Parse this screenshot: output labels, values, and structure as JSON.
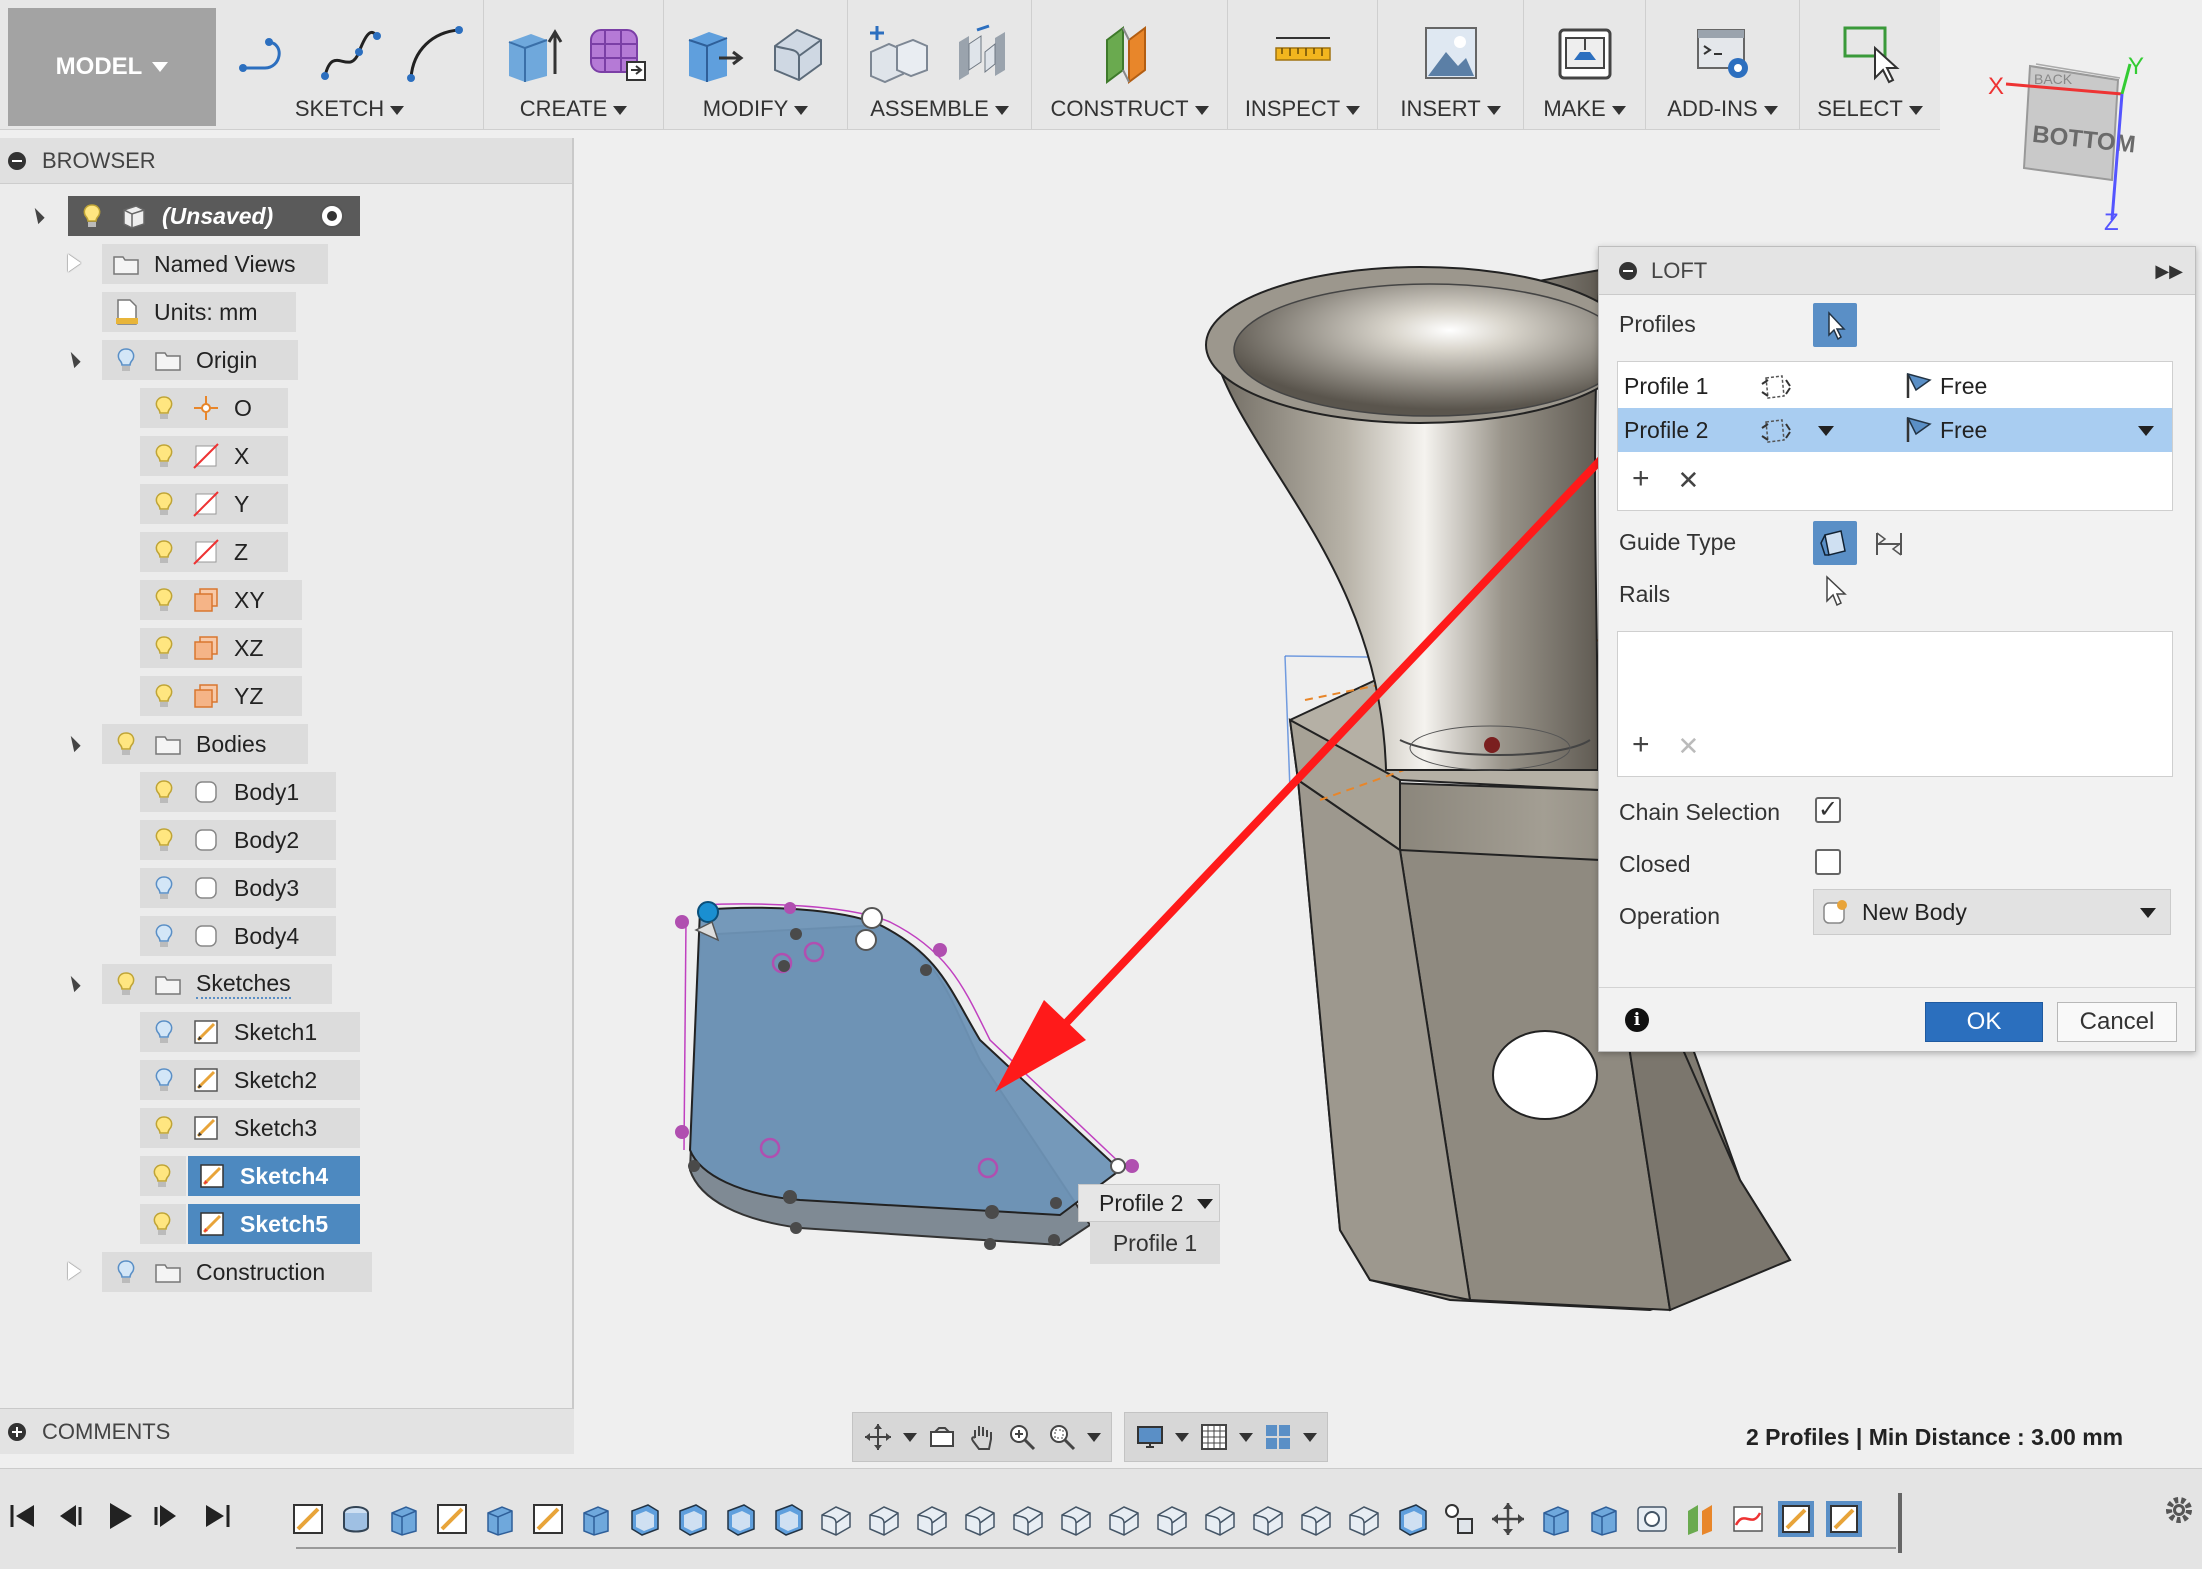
{
  "toolbar": {
    "model": "MODEL",
    "groups": [
      {
        "label": "SKETCH"
      },
      {
        "label": "CREATE"
      },
      {
        "label": "MODIFY"
      },
      {
        "label": "ASSEMBLE"
      },
      {
        "label": "CONSTRUCT"
      },
      {
        "label": "INSPECT"
      },
      {
        "label": "INSERT"
      },
      {
        "label": "MAKE"
      },
      {
        "label": "ADD-INS"
      },
      {
        "label": "SELECT"
      }
    ]
  },
  "viewcube": {
    "face": "BOTTOM",
    "back_face": "BACK",
    "x": "X",
    "y": "Y",
    "z": "Z"
  },
  "browser": {
    "title": "BROWSER",
    "root": "(Unsaved)",
    "named_views": "Named Views",
    "units": "Units: mm",
    "origin": "Origin",
    "origin_items": [
      "O",
      "X",
      "Y",
      "Z",
      "XY",
      "XZ",
      "YZ"
    ],
    "bodies": "Bodies",
    "body_items": [
      "Body1",
      "Body2",
      "Body3",
      "Body4"
    ],
    "sketches": "Sketches",
    "sketch_items": [
      "Sketch1",
      "Sketch2",
      "Sketch3",
      "Sketch4",
      "Sketch5"
    ],
    "construction": "Construction"
  },
  "comments": {
    "title": "COMMENTS"
  },
  "loft": {
    "title": "LOFT",
    "profiles_label": "Profiles",
    "profiles": [
      {
        "name": "Profile 1",
        "condition": "Free"
      },
      {
        "name": "Profile 2",
        "condition": "Free"
      }
    ],
    "guide_type_label": "Guide Type",
    "rails_label": "Rails",
    "chain_selection_label": "Chain Selection",
    "chain_selection": true,
    "closed_label": "Closed",
    "closed": false,
    "operation_label": "Operation",
    "operation_value": "New Body",
    "ok": "OK",
    "cancel": "Cancel"
  },
  "profile_popup": {
    "item1": "Profile 2",
    "item2": "Profile 1"
  },
  "status": "2 Profiles | Min Distance : 3.00 mm",
  "colors": {
    "accent": "#4d89c0",
    "selection": "#a9cdf1",
    "annotation_arrow": "#ff1a1a",
    "profile_fill": "#6e93b6"
  }
}
